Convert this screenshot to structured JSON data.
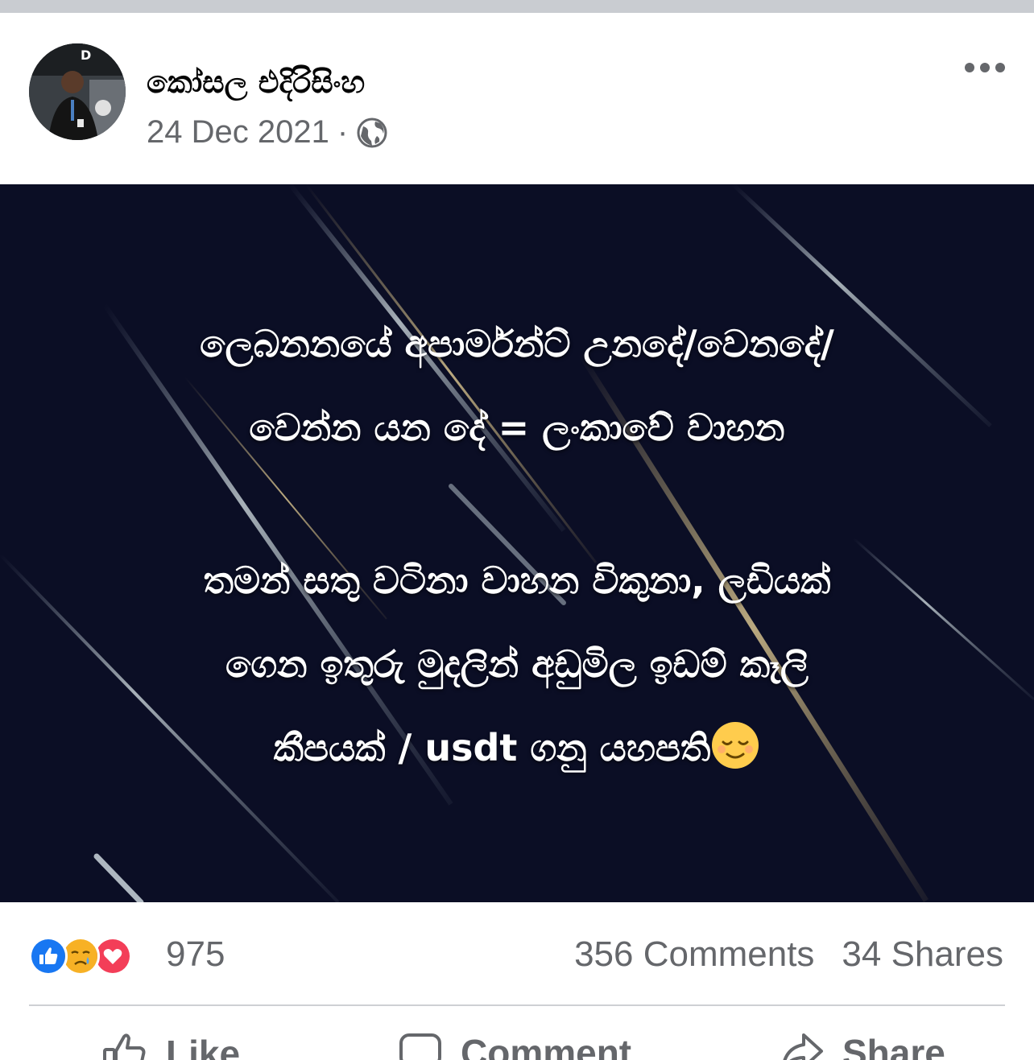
{
  "post": {
    "author": "කෝසල එදිරිසිංහ",
    "date": "24 Dec 2021",
    "separator": "·",
    "avatar_badge": "D"
  },
  "image_text": {
    "line1": "ලෙබනනයේ අපාර්මන්ට් උනදේ/වෙනදේ/",
    "line2": "වෙන්න යන දේ = ලංකාවේ වාහන",
    "line3": "තමන් සතු වටිනා වාහන විකුනා, ලඩියක්",
    "line4": "ගෙන ඉතුරු මුදලින් අඩුමිල ඉඩම් කෑලි",
    "line5": "කීපයක් / usdt ගනු යහපති"
  },
  "stats": {
    "reaction_count": "975",
    "comments": "356 Comments",
    "shares": "34 Shares",
    "reactions": [
      "like-icon",
      "care-icon",
      "love-icon"
    ]
  },
  "actions": {
    "like": "Like",
    "comment": "Comment",
    "share": "Share"
  },
  "colors": {
    "image_bg": "#0b0e25",
    "like_blue": "#1877f2",
    "love_red": "#f33e58",
    "care_yellow": "#f7b125",
    "muted_text": "#65676b"
  }
}
